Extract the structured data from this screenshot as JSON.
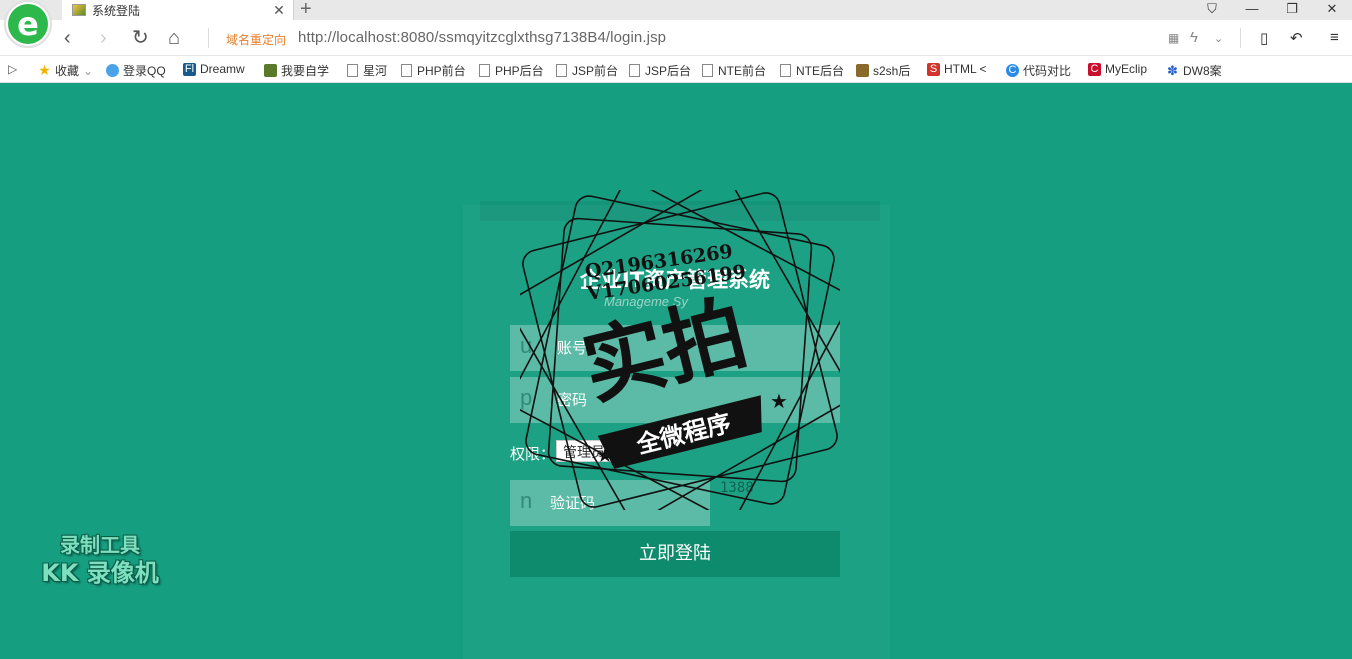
{
  "browser": {
    "tab_title": "系统登陆",
    "new_tab_symbol": "+",
    "redirect_label": "域名重定向",
    "url": "http://localhost:8080/ssmqyitzcglxthsg7138B4/login.jsp"
  },
  "bookmarks": [
    {
      "label": "收藏",
      "icon": "star-icon"
    },
    {
      "label": "登录QQ",
      "icon": "qq-icon"
    },
    {
      "label": "Dreamw",
      "icon": "dreamweaver-icon"
    },
    {
      "label": "我要自学",
      "icon": "book-icon"
    },
    {
      "label": "星河",
      "icon": "doc-icon"
    },
    {
      "label": "PHP前台",
      "icon": "doc-icon"
    },
    {
      "label": "PHP后台",
      "icon": "doc-icon"
    },
    {
      "label": "JSP前台",
      "icon": "doc-icon"
    },
    {
      "label": "JSP后台",
      "icon": "doc-icon"
    },
    {
      "label": "NTE前台",
      "icon": "doc-icon"
    },
    {
      "label": "NTE后台",
      "icon": "doc-icon"
    },
    {
      "label": "s2sh后",
      "icon": "image-icon"
    },
    {
      "label": "HTML <",
      "icon": "html-icon"
    },
    {
      "label": "代码对比",
      "icon": "compare-icon"
    },
    {
      "label": "MyEclip",
      "icon": "myeclipse-icon"
    },
    {
      "label": "DW8案",
      "icon": "paw-icon"
    }
  ],
  "login": {
    "system_title": "企业IT资产管理系统",
    "system_subtitle": "Manageme   Sy",
    "username_letter": "u",
    "username_placeholder": "账号",
    "password_letter": "p",
    "password_placeholder": "密码",
    "permission_label": "权限：",
    "permission_value": "管理员",
    "captcha_letter": "n",
    "captcha_placeholder": "验证码",
    "captcha_code": "1388",
    "submit_label": "立即登陆"
  },
  "stamp": {
    "line1": "Q2196316269",
    "line2": "V17060256199",
    "main": "实拍",
    "ribbon": "全微程序"
  },
  "watermark": {
    "line1": "录制工具",
    "line2": "KK 录像机"
  }
}
